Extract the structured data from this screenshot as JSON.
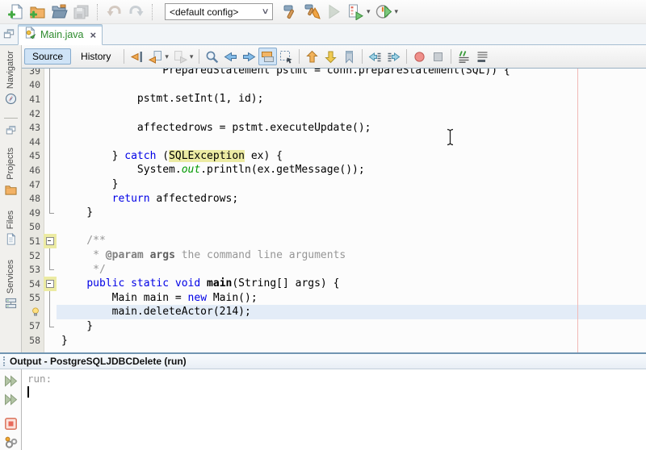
{
  "main_toolbar": {
    "config_value": "<default config>",
    "left_icons": [
      {
        "name": "new-file"
      },
      {
        "name": "new-project"
      },
      {
        "name": "open-project"
      },
      {
        "name": "save-all",
        "disabled": true
      },
      {
        "sep": true
      },
      {
        "name": "undo",
        "disabled": true
      },
      {
        "name": "redo",
        "disabled": true
      },
      {
        "sep": true
      }
    ],
    "right_icons": [
      {
        "name": "build-project"
      },
      {
        "name": "clean-build-project"
      },
      {
        "name": "run-project",
        "disabled": true
      },
      {
        "name": "debug-project",
        "dropdown": true
      },
      {
        "name": "profile-project",
        "dropdown": true
      }
    ]
  },
  "tab_bar": {
    "active_tab": "Main.java"
  },
  "editor_toolbar": {
    "source_label": "Source",
    "history_label": "History",
    "icons": [
      {
        "name": "last-edit-position"
      },
      {
        "name": "back",
        "dropdown": true
      },
      {
        "name": "forward",
        "dropdown": true,
        "disabled": true
      },
      {
        "sep": true
      },
      {
        "name": "find-selection"
      },
      {
        "name": "previous-occurrence"
      },
      {
        "name": "next-occurrence"
      },
      {
        "name": "toggle-highlight-search",
        "selected": true
      },
      {
        "name": "rectangular-selection"
      },
      {
        "sep": true
      },
      {
        "name": "previous-bookmark"
      },
      {
        "name": "next-bookmark"
      },
      {
        "name": "toggle-bookmark"
      },
      {
        "sep": true
      },
      {
        "name": "shift-line-left"
      },
      {
        "name": "shift-line-right"
      },
      {
        "sep": true
      },
      {
        "name": "start-macro-recording"
      },
      {
        "name": "stop-macro-recording"
      },
      {
        "sep": true
      },
      {
        "name": "comment"
      },
      {
        "name": "uncomment"
      }
    ]
  },
  "sidebar": {
    "tabs": [
      {
        "label": "Navigator",
        "icon": "compass"
      },
      {
        "label": "Projects",
        "icon": "projects-folder"
      },
      {
        "label": "Files",
        "icon": "files-page"
      },
      {
        "label": "Services",
        "icon": "services"
      }
    ],
    "group_icon": "cascade-windows"
  },
  "editor": {
    "colors": {
      "keyword": "#0000e6",
      "field": "#009900",
      "comment": "#969696",
      "occurrence_bg": "#eceba3",
      "current_line_bg": "#e3ecf7",
      "margin_line": "#f1b9b6",
      "tab_label": "#2e8b2e"
    },
    "lines": [
      {
        "n": "39",
        "fold": "v",
        "seg": [
          [
            "p",
            "                PreparedStatement pstmt = conn.prepareStatement(SQL)) {"
          ]
        ]
      },
      {
        "n": "40",
        "fold": "v",
        "seg": []
      },
      {
        "n": "41",
        "fold": "v",
        "seg": [
          [
            "p",
            "            pstmt.setInt(1, id);"
          ]
        ]
      },
      {
        "n": "42",
        "fold": "v",
        "seg": []
      },
      {
        "n": "43",
        "fold": "v",
        "seg": [
          [
            "p",
            "            affectedrows = pstmt.executeUpdate();"
          ]
        ]
      },
      {
        "n": "44",
        "fold": "v",
        "seg": []
      },
      {
        "n": "45",
        "fold": "v",
        "seg": [
          [
            "p",
            "        } "
          ],
          [
            "k",
            "catch"
          ],
          [
            "p",
            " ("
          ],
          [
            "m",
            "SQLException"
          ],
          [
            "p",
            " ex) {"
          ]
        ]
      },
      {
        "n": "46",
        "fold": "v",
        "seg": [
          [
            "p",
            "            System."
          ],
          [
            "f",
            "out"
          ],
          [
            "p",
            ".println(ex.getMessage());"
          ]
        ]
      },
      {
        "n": "47",
        "fold": "v",
        "seg": [
          [
            "p",
            "        }"
          ]
        ]
      },
      {
        "n": "48",
        "fold": "v",
        "seg": [
          [
            "p",
            "        "
          ],
          [
            "k",
            "return"
          ],
          [
            "p",
            " affectedrows;"
          ]
        ]
      },
      {
        "n": "49",
        "fold": "e",
        "seg": [
          [
            "p",
            "    }"
          ]
        ]
      },
      {
        "n": "50",
        "fold": "",
        "seg": []
      },
      {
        "n": "51",
        "fold": "m",
        "seg": [
          [
            "c",
            "    /**"
          ]
        ]
      },
      {
        "n": "52",
        "fold": "v",
        "seg": [
          [
            "c",
            "     * "
          ],
          [
            "ct",
            "@param"
          ],
          [
            "c",
            " "
          ],
          [
            "cb",
            "args"
          ],
          [
            "c",
            " the command line arguments"
          ]
        ]
      },
      {
        "n": "53",
        "fold": "e",
        "seg": [
          [
            "c",
            "     */"
          ]
        ]
      },
      {
        "n": "54",
        "fold": "m",
        "seg": [
          [
            "p",
            "    "
          ],
          [
            "k",
            "public"
          ],
          [
            "p",
            " "
          ],
          [
            "k",
            "static"
          ],
          [
            "p",
            " "
          ],
          [
            "k",
            "void"
          ],
          [
            "p",
            " "
          ],
          [
            "b",
            "main"
          ],
          [
            "p",
            "(String[] args) {"
          ]
        ]
      },
      {
        "n": "55",
        "fold": "v",
        "seg": [
          [
            "p",
            "        Main main = "
          ],
          [
            "k",
            "new"
          ],
          [
            "p",
            " Main();"
          ]
        ]
      },
      {
        "n": "56",
        "fold": "v",
        "bulb": true,
        "current": true,
        "seg": [
          [
            "p",
            "        main.deleteActor(214);"
          ]
        ]
      },
      {
        "n": "57",
        "fold": "e",
        "seg": [
          [
            "p",
            "    }"
          ]
        ]
      },
      {
        "n": "58",
        "fold": "",
        "seg": [
          [
            "p",
            "}"
          ]
        ]
      }
    ]
  },
  "output": {
    "title": "Output - PostgreSQLJDBCDelete (run)",
    "text": "run:",
    "buttons": [
      {
        "name": "rerun"
      },
      {
        "name": "rerun-with-changes"
      },
      {
        "name": "stop-run",
        "gap": true
      },
      {
        "name": "ant-settings"
      }
    ]
  }
}
